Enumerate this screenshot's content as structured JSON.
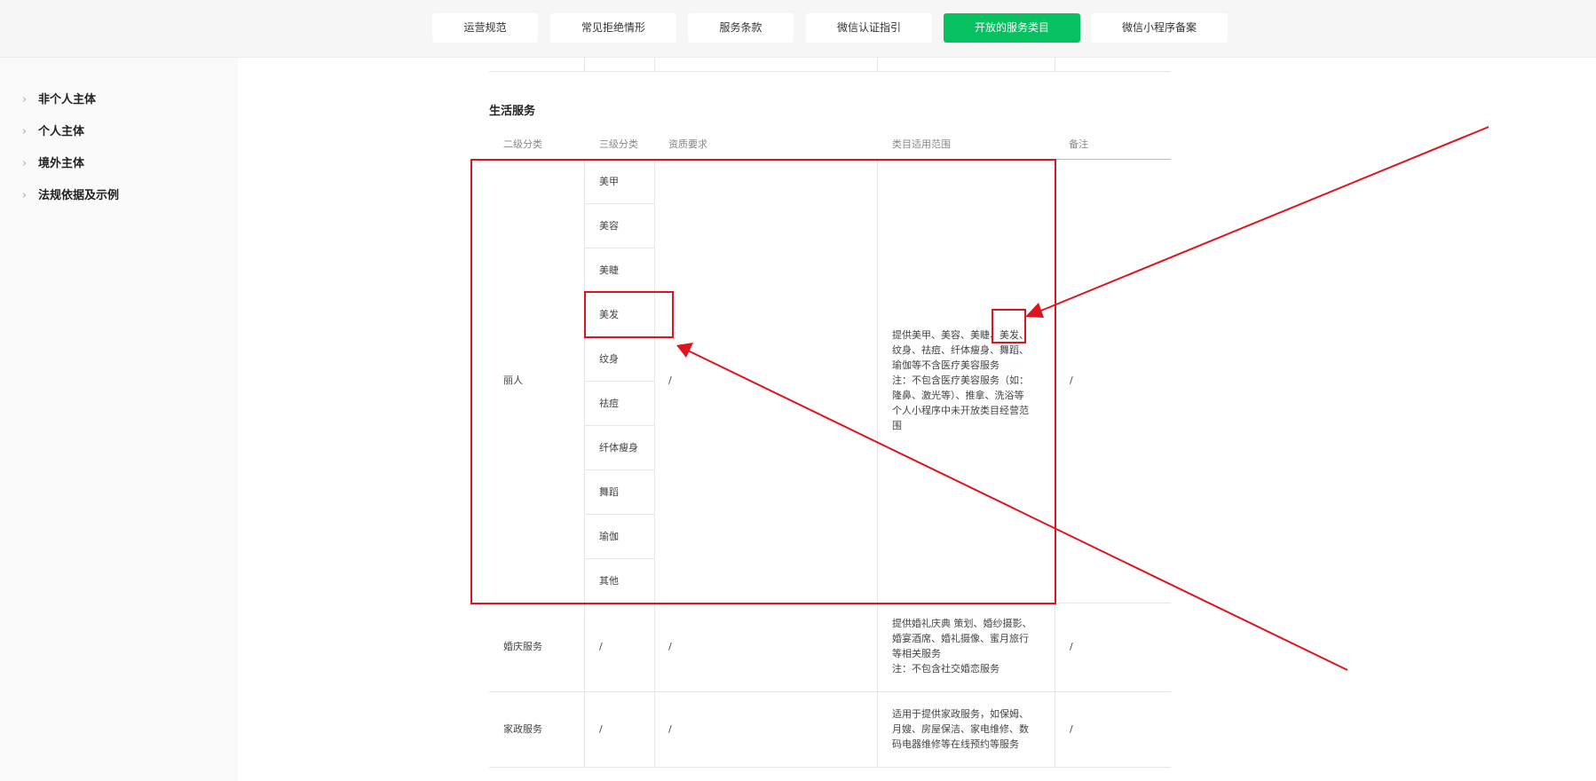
{
  "nav": {
    "tabs": [
      {
        "label": "运营规范"
      },
      {
        "label": "常见拒绝情形"
      },
      {
        "label": "服务条款"
      },
      {
        "label": "微信认证指引"
      },
      {
        "label": "开放的服务类目"
      },
      {
        "label": "微信小程序备案"
      }
    ],
    "active_index": 4
  },
  "sidebar": {
    "items": [
      {
        "label": "非个人主体"
      },
      {
        "label": "个人主体"
      },
      {
        "label": "境外主体"
      },
      {
        "label": "法规依据及示例"
      }
    ]
  },
  "section": {
    "title": "生活服务",
    "headers": {
      "level2": "二级分类",
      "level3": "三级分类",
      "qualification": "资质要求",
      "scope": "类目适用范围",
      "note": "备注"
    },
    "rows": {
      "beauty": {
        "level2": "丽人",
        "subcategories": [
          "美甲",
          "美容",
          "美睫",
          "美发",
          "纹身",
          "祛痘",
          "纤体瘦身",
          "舞蹈",
          "瑜伽",
          "其他"
        ],
        "qualification": "/",
        "scope_lines": [
          "提供美甲、美容、美睫、美发、",
          "纹身、祛痘、纤体瘦身、舞蹈、",
          "瑜伽等不含医疗美容服务",
          "注：不包含医疗美容服务（如：",
          "隆鼻、激光等）、推拿、洗浴等",
          "个人小程序中未开放类目经营范",
          "围"
        ],
        "note": "/"
      },
      "wedding": {
        "level2": "婚庆服务",
        "level3": "/",
        "qualification": "/",
        "scope_lines": [
          "提供婚礼庆典 策划、婚纱摄影、",
          "婚宴酒席、婚礼摄像、蜜月旅行",
          "等相关服务",
          "注：不包含社交婚恋服务"
        ],
        "note": "/"
      },
      "housekeeping": {
        "level2": "家政服务",
        "level3": "/",
        "qualification": "/",
        "scope_lines": [
          "适用于提供家政服务，如保姆、",
          "月嫂、房屋保洁、家电维修、数",
          "码电器维修等在线预约等服务"
        ],
        "note": "/"
      }
    }
  },
  "annotation_color": "#e0141e"
}
